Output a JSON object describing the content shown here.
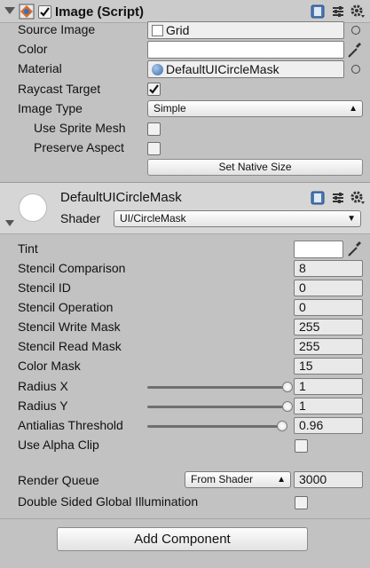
{
  "image_script": {
    "title": "Image (Script)",
    "source_image": {
      "label": "Source Image",
      "value": "Grid"
    },
    "color": {
      "label": "Color"
    },
    "material": {
      "label": "Material",
      "value": "DefaultUICircleMask"
    },
    "raycast_target": {
      "label": "Raycast Target",
      "checked": true
    },
    "image_type": {
      "label": "Image Type",
      "value": "Simple"
    },
    "use_sprite_mesh": {
      "label": "Use Sprite Mesh",
      "checked": false
    },
    "preserve_aspect": {
      "label": "Preserve Aspect",
      "checked": false
    },
    "set_native_size": "Set Native Size"
  },
  "material_section": {
    "name": "DefaultUICircleMask",
    "shader_label": "Shader",
    "shader_value": "UI/CircleMask",
    "properties": [
      {
        "label": "Tint",
        "kind": "color"
      },
      {
        "label": "Stencil Comparison",
        "value": "8"
      },
      {
        "label": "Stencil ID",
        "value": "0"
      },
      {
        "label": "Stencil Operation",
        "value": "0"
      },
      {
        "label": "Stencil Write Mask",
        "value": "255"
      },
      {
        "label": "Stencil Read Mask",
        "value": "255"
      },
      {
        "label": "Color Mask",
        "value": "15"
      },
      {
        "label": "Radius X",
        "value": "1",
        "slider_fraction": 1.0
      },
      {
        "label": "Radius Y",
        "value": "1",
        "slider_fraction": 1.0
      },
      {
        "label": "Antialias Threshold",
        "value": "0.96",
        "slider_fraction": 0.96
      },
      {
        "label": "Use Alpha Clip",
        "checked": false
      }
    ],
    "render_queue": {
      "label": "Render Queue",
      "mode": "From Shader",
      "value": "3000"
    },
    "double_sided_gi": {
      "label": "Double Sided Global Illumination",
      "checked": false
    }
  },
  "add_component": "Add Component",
  "colors": {
    "panel": "#c2c2c2",
    "field": "#efefef",
    "accent": "#1f4e8c"
  }
}
